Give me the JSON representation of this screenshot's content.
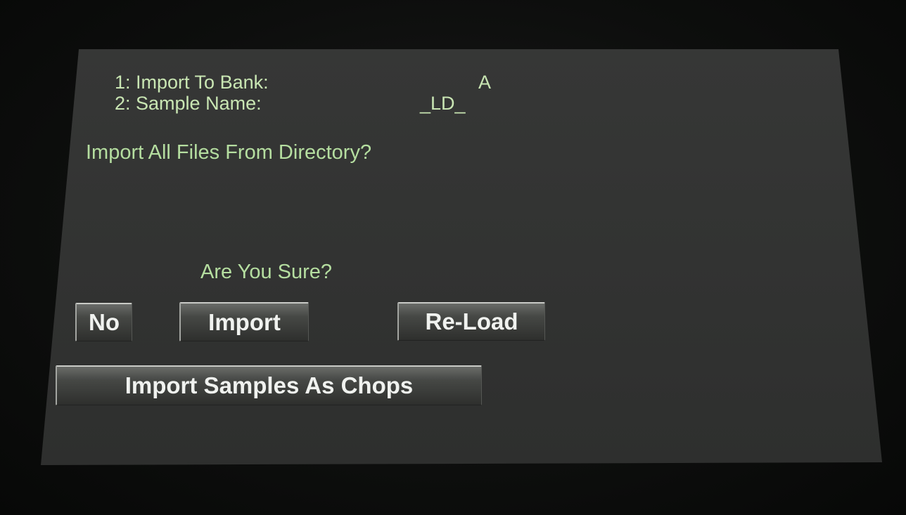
{
  "params": [
    {
      "label": "1: Import To Bank:",
      "value": "A"
    },
    {
      "label": "2: Sample Name:",
      "value": "_LD_"
    }
  ],
  "dialog": {
    "question": "Import All Files From Directory?",
    "confirm_prompt": "Are You Sure?"
  },
  "buttons": {
    "no": "No",
    "import": "Import",
    "reload": "Re-Load",
    "import_chops": "Import Samples As Chops"
  }
}
